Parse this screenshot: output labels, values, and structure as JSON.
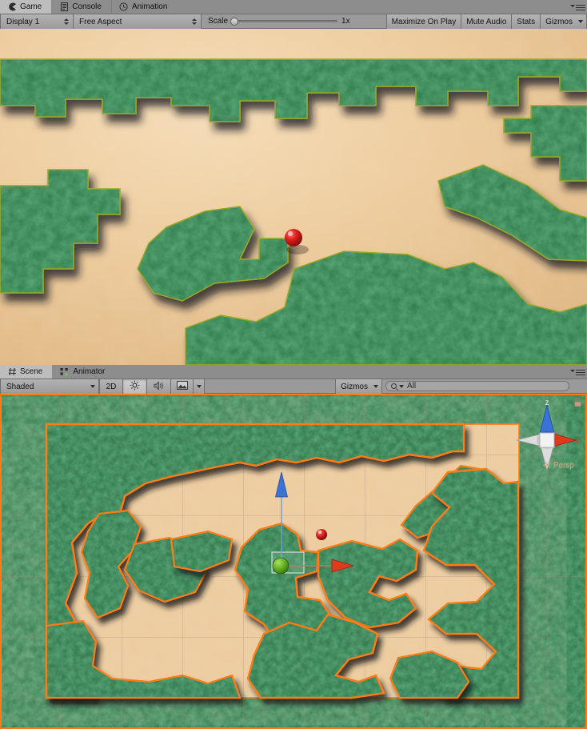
{
  "game_panel": {
    "tabs": [
      {
        "label": "Game",
        "icon": "game-pacman-icon",
        "active": true
      },
      {
        "label": "Console",
        "icon": "console-icon",
        "active": false
      },
      {
        "label": "Animation",
        "icon": "clock-icon",
        "active": false
      }
    ],
    "panel_menu_icon": "panel-options-icon",
    "toolbar": {
      "display": "Display 1",
      "aspect": "Free Aspect",
      "scale_label": "Scale",
      "scale_value": "1x",
      "scale_percent": 0,
      "maximize_on_play": "Maximize On Play",
      "mute_audio": "Mute Audio",
      "stats": "Stats",
      "gizmos": "Gizmos"
    }
  },
  "scene_panel": {
    "tabs": [
      {
        "label": "Scene",
        "icon": "scene-grid-icon",
        "active": true
      },
      {
        "label": "Animator",
        "icon": "animator-nodes-icon",
        "active": false
      }
    ],
    "panel_menu_icon": "panel-options-icon",
    "toolbar": {
      "draw_mode": "Shaded",
      "two_d": "2D",
      "lighting_icon": "sun-icon",
      "audio_icon": "speaker-icon",
      "effects_icon": "image-icon",
      "gizmos": "Gizmos",
      "search_value": "All",
      "search_placeholder": "Search"
    },
    "nav_gizmo": {
      "axis_up": "z",
      "axis_right": "x",
      "projection": "Persp",
      "lock_icon": "lock-icon",
      "color_z": "#3a73d6",
      "color_x": "#e03a1d",
      "color_neutral": "#e8e8e8"
    },
    "selection": {
      "outline_color": "#ff7b17",
      "move_gizmo": {
        "z_axis_color": "#4a7fd4",
        "x_axis_color": "#d8432a",
        "center_handle_color": "#62b022"
      }
    }
  },
  "colors": {
    "chrome_tabstrip": "#8d8d8d",
    "chrome_toolbar": "#9a9a9a",
    "active_tab": "#bdbdbd",
    "sand": "#eccb9e",
    "moss": "#2f7a4a",
    "moss_light": "#4fa868",
    "accent_orange": "#ff7b17",
    "sphere_red": "#d91f1f"
  },
  "scene_content": {
    "grid_visible": true,
    "terrain_type": "hex-tile plateau",
    "objects": [
      {
        "name": "red-sphere",
        "kind": "sphere",
        "color": "#d91f1f"
      },
      {
        "name": "selected-terrain",
        "kind": "mesh",
        "outlined": true
      }
    ]
  }
}
